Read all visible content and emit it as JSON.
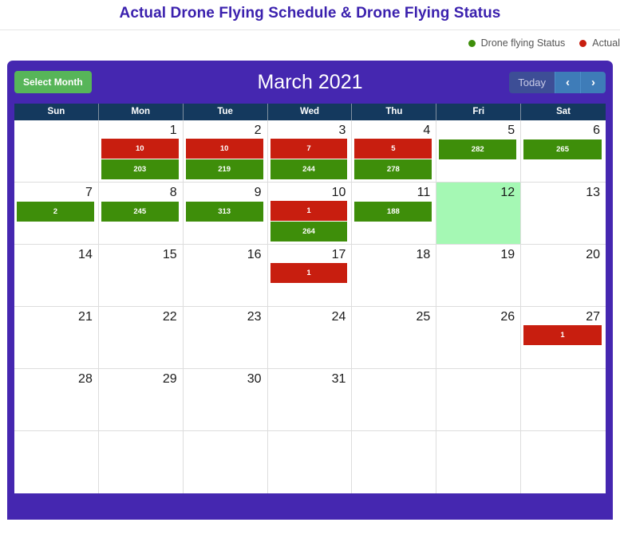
{
  "page": {
    "title": "Actual Drone Flying Schedule & Drone Flying Status"
  },
  "legend": {
    "items": [
      {
        "label": "Drone flying Status",
        "color": "#3E8E0A",
        "icon": "green-dot-icon"
      },
      {
        "label": "Actual",
        "color": "#C81E0F",
        "icon": "red-dot-icon"
      }
    ]
  },
  "calendar": {
    "select_month_label": "Select Month",
    "month_title": "March 2021",
    "today_label": "Today",
    "prev_label": "‹",
    "next_label": "›",
    "accent_purple": "#4527B0",
    "header_navy": "#14395E",
    "today_highlight": "#A5F8B4",
    "day_names": [
      "Sun",
      "Mon",
      "Tue",
      "Wed",
      "Thu",
      "Fri",
      "Sat"
    ],
    "weeks": [
      [
        {
          "day": "",
          "today": false,
          "events": []
        },
        {
          "day": "1",
          "today": false,
          "events": [
            {
              "type": "actual",
              "value": "10"
            },
            {
              "type": "status",
              "value": "203"
            }
          ]
        },
        {
          "day": "2",
          "today": false,
          "events": [
            {
              "type": "actual",
              "value": "10"
            },
            {
              "type": "status",
              "value": "219"
            }
          ]
        },
        {
          "day": "3",
          "today": false,
          "events": [
            {
              "type": "actual",
              "value": "7"
            },
            {
              "type": "status",
              "value": "244"
            }
          ]
        },
        {
          "day": "4",
          "today": false,
          "events": [
            {
              "type": "actual",
              "value": "5"
            },
            {
              "type": "status",
              "value": "278"
            }
          ]
        },
        {
          "day": "5",
          "today": false,
          "events": [
            {
              "type": "status",
              "value": "282"
            }
          ]
        },
        {
          "day": "6",
          "today": false,
          "events": [
            {
              "type": "status",
              "value": "265"
            }
          ]
        }
      ],
      [
        {
          "day": "7",
          "today": false,
          "events": [
            {
              "type": "status",
              "value": "2"
            }
          ]
        },
        {
          "day": "8",
          "today": false,
          "events": [
            {
              "type": "status",
              "value": "245"
            }
          ]
        },
        {
          "day": "9",
          "today": false,
          "events": [
            {
              "type": "status",
              "value": "313"
            }
          ]
        },
        {
          "day": "10",
          "today": false,
          "events": [
            {
              "type": "actual",
              "value": "1"
            },
            {
              "type": "status",
              "value": "264"
            }
          ]
        },
        {
          "day": "11",
          "today": false,
          "events": [
            {
              "type": "status",
              "value": "188"
            }
          ]
        },
        {
          "day": "12",
          "today": true,
          "events": []
        },
        {
          "day": "13",
          "today": false,
          "events": []
        }
      ],
      [
        {
          "day": "14",
          "today": false,
          "events": []
        },
        {
          "day": "15",
          "today": false,
          "events": []
        },
        {
          "day": "16",
          "today": false,
          "events": []
        },
        {
          "day": "17",
          "today": false,
          "events": [
            {
              "type": "actual",
              "value": "1"
            }
          ]
        },
        {
          "day": "18",
          "today": false,
          "events": []
        },
        {
          "day": "19",
          "today": false,
          "events": []
        },
        {
          "day": "20",
          "today": false,
          "events": []
        }
      ],
      [
        {
          "day": "21",
          "today": false,
          "events": []
        },
        {
          "day": "22",
          "today": false,
          "events": []
        },
        {
          "day": "23",
          "today": false,
          "events": []
        },
        {
          "day": "24",
          "today": false,
          "events": []
        },
        {
          "day": "25",
          "today": false,
          "events": []
        },
        {
          "day": "26",
          "today": false,
          "events": []
        },
        {
          "day": "27",
          "today": false,
          "events": [
            {
              "type": "actual",
              "value": "1"
            }
          ]
        }
      ],
      [
        {
          "day": "28",
          "today": false,
          "events": []
        },
        {
          "day": "29",
          "today": false,
          "events": []
        },
        {
          "day": "30",
          "today": false,
          "events": []
        },
        {
          "day": "31",
          "today": false,
          "events": []
        },
        {
          "day": "",
          "today": false,
          "events": []
        },
        {
          "day": "",
          "today": false,
          "events": []
        },
        {
          "day": "",
          "today": false,
          "events": []
        }
      ],
      [
        {
          "day": "",
          "today": false,
          "events": []
        },
        {
          "day": "",
          "today": false,
          "events": []
        },
        {
          "day": "",
          "today": false,
          "events": []
        },
        {
          "day": "",
          "today": false,
          "events": []
        },
        {
          "day": "",
          "today": false,
          "events": []
        },
        {
          "day": "",
          "today": false,
          "events": []
        },
        {
          "day": "",
          "today": false,
          "events": []
        }
      ]
    ]
  }
}
